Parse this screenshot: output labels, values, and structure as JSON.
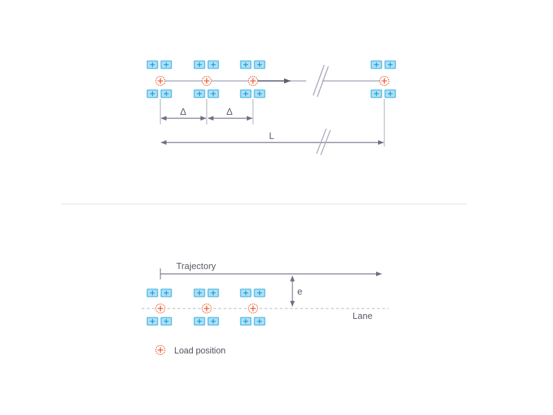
{
  "figure": {
    "title_visible": false,
    "colors": {
      "sensor_fill": "#addff5",
      "sensor_stroke": "#29abe2",
      "sensor_plus": "#29abe2",
      "load_stroke": "#e8562a",
      "beam_line": "#b6b6c4",
      "dimension_line": "#6f6f86",
      "lane_dashed": "#c2c2c8",
      "trajectory_line": "#6f6f86",
      "divider": "#e4e4e8",
      "text": "#595966"
    }
  },
  "top_diagram": {
    "name": "beam-sensor-layout",
    "beam_label": "",
    "dimension_labels": {
      "delta_1": "Δ",
      "delta_2": "Δ",
      "length": "L"
    },
    "load_positions_count": 4,
    "sensor_pair_groups_count": 4,
    "break_symbols_count": 2,
    "direction_arrow": "right-arrow"
  },
  "bottom_diagram": {
    "name": "lane-trajectory-layout",
    "trajectory_label": "Trajectory",
    "eccentricity_label": "e",
    "lane_label": "Lane",
    "load_positions_count": 3,
    "sensor_pair_groups_count": 3
  },
  "legend": {
    "marker_name": "load-position-marker",
    "label": "Load position"
  }
}
